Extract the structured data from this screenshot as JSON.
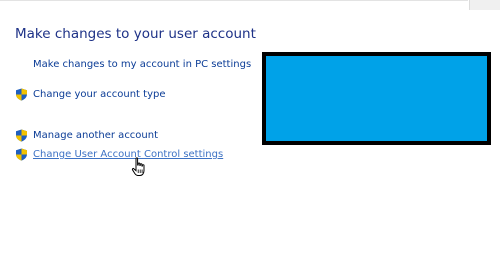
{
  "page": {
    "title": "Make changes to your user account"
  },
  "tasks": [
    {
      "label": "Make changes to my account in PC settings",
      "has_shield": false
    },
    {
      "label": "Change your account type",
      "has_shield": true
    },
    {
      "label": "Manage another account",
      "has_shield": true
    },
    {
      "label": "Change User Account Control settings",
      "has_shield": true,
      "hovered": true
    }
  ],
  "icons": {
    "uac_shield": "uac-shield-icon",
    "pointer": "hand-pointer-icon"
  },
  "colors": {
    "title": "#1e3287",
    "link": "#0b3c96",
    "link_hover": "#3d72c4",
    "redaction_fill": "#00a2e8",
    "redaction_border": "#000000"
  }
}
